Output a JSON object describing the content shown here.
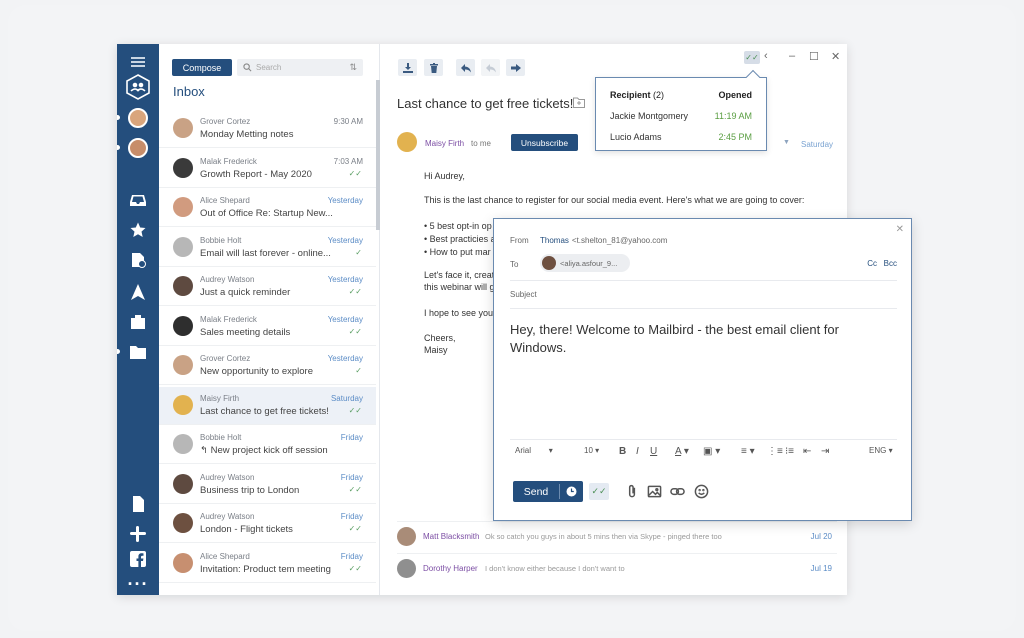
{
  "list": {
    "compose": "Compose",
    "search_placeholder": "Search",
    "title": "Inbox",
    "messages": [
      {
        "name": "Grover Cortez",
        "subject": "Monday Metting notes",
        "time": "9:30 AM",
        "check": ""
      },
      {
        "name": "Malak Frederick",
        "subject": "Growth Report - May 2020",
        "time": "7:03 AM",
        "check": "✓✓"
      },
      {
        "name": "Alice Shepard",
        "subject": "Out of Office Re: Startup New...",
        "time": "Yesterday",
        "check": ""
      },
      {
        "name": "Bobbie Holt",
        "subject": "Email will last forever - online...",
        "time": "Yesterday",
        "check": "✓"
      },
      {
        "name": "Audrey Watson",
        "subject": "Just a quick reminder",
        "time": "Yesterday",
        "check": "✓✓"
      },
      {
        "name": "Malak Frederick",
        "subject": "Sales meeting details",
        "time": "Yesterday",
        "check": "✓✓"
      },
      {
        "name": "Grover Cortez",
        "subject": "New opportunity to explore",
        "time": "Yesterday",
        "check": "✓"
      },
      {
        "name": "Maisy Firth",
        "subject": "Last chance to get free tickets!",
        "time": "Saturday",
        "check": "✓✓"
      },
      {
        "name": "Bobbie Holt",
        "subject": "↰ New project kick off session",
        "time": "Friday",
        "check": ""
      },
      {
        "name": "Audrey Watson",
        "subject": "Business trip to London",
        "time": "Friday",
        "check": "✓✓"
      },
      {
        "name": "Audrey Watson",
        "subject": "London - Flight tickets",
        "time": "Friday",
        "check": "✓✓"
      },
      {
        "name": "Alice Shepard",
        "subject": "Invitation: Product tem meeting",
        "time": "Friday",
        "check": "✓✓"
      }
    ]
  },
  "reading": {
    "subject": "Last chance to get free tickets!",
    "sender": "Maisy Firth",
    "to_me": "to me",
    "unsubscribe": "Unsubscribe",
    "date": "Saturday",
    "body": [
      "Hi Audrey,",
      "This is the last chance to register for our social media event. Here's what we are going to cover:",
      "• 5 best opt-in op",
      "• Best practicies a",
      "• How to put mar",
      "Let's face it, creat",
      "this webinar will g",
      "I hope to see you",
      "Cheers,",
      "Maisy"
    ],
    "thread": [
      {
        "name": "Matt Blacksmith",
        "message": "Ok so catch you guys in about 5 mins then via Skype - pinged there too",
        "date": "Jul 20"
      },
      {
        "name": "Dorothy Harper",
        "message": "I don't know either because I don't want to",
        "date": "Jul 19"
      }
    ]
  },
  "recipients": {
    "header_label": "Recipient",
    "header_count": "(2)",
    "header_opened": "Opened",
    "rows": [
      {
        "name": "Jackie Montgomery",
        "time": "11:19 AM"
      },
      {
        "name": "Lucio Adams",
        "time": "2:45 PM"
      }
    ]
  },
  "compose": {
    "from_label": "From",
    "from_name": "Thomas",
    "from_email": "<t.shelton_81@yahoo.com",
    "to_label": "To",
    "to_chip": "<aliya.asfour_9...",
    "cc": "Cc",
    "bcc": "Bcc",
    "subject_label": "Subject",
    "body": "Hey, there! Welcome to Mailbird - the best email client for Windows.",
    "font": "Arial",
    "size": "10",
    "lang": "ENG",
    "send": "Send"
  },
  "colors": {
    "brand": "#244e7d",
    "link": "#5b8cc6",
    "sender": "#7c4ea4",
    "opened": "#5a9e42"
  }
}
